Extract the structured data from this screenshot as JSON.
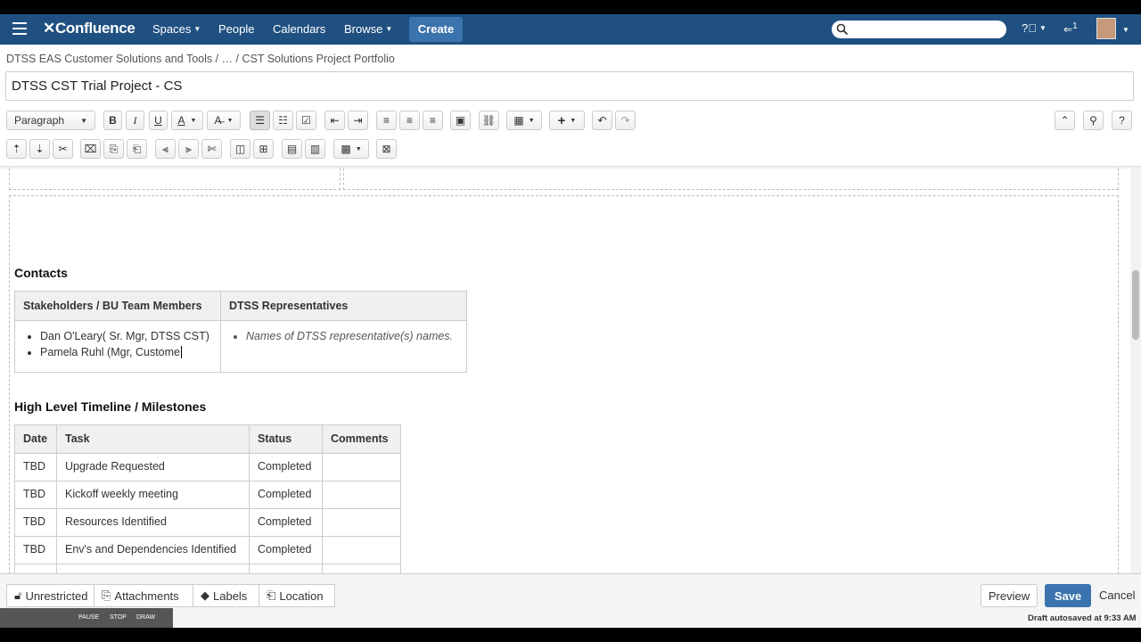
{
  "nav": {
    "logo": "Confluence",
    "items": [
      "Spaces",
      "People",
      "Calendars",
      "Browse"
    ],
    "create": "Create",
    "notif_count": "1"
  },
  "breadcrumb": "DTSS EAS Customer Solutions and Tools / … / CST Solutions Project Portfolio",
  "page_title": "DTSS CST Trial Project - CS",
  "toolbar": {
    "paragraph": "Paragraph",
    "bold": "B",
    "italic": "I",
    "underline": "U",
    "color": "A"
  },
  "contacts": {
    "heading": "Contacts",
    "col1": "Stakeholders / BU Team Members",
    "col2": "DTSS Representatives",
    "stakeholders": [
      "Dan O'Leary( Sr. Mgr, DTSS CST)",
      "Pamela Ruhl (Mgr, Custome"
    ],
    "reps": [
      "Names of DTSS representative(s) names."
    ]
  },
  "milestones": {
    "heading": "High Level Timeline / Milestones",
    "columns": [
      "Date",
      "Task",
      "Status",
      "Comments"
    ],
    "rows": [
      [
        "TBD",
        "Upgrade Requested",
        "Completed",
        ""
      ],
      [
        "TBD",
        "Kickoff weekly meeting",
        "Completed",
        ""
      ],
      [
        "TBD",
        "Resources Identified",
        "Completed",
        ""
      ],
      [
        "TBD",
        "Env's and Dependencies Identified",
        "Completed",
        ""
      ]
    ]
  },
  "footer": {
    "restrictions": "Unrestricted",
    "attachments": "Attachments",
    "labels": "Labels",
    "location": "Location",
    "preview": "Preview",
    "save": "Save",
    "cancel": "Cancel",
    "autosave": "Draft autosaved at 9:33 AM",
    "recorder": [
      "PAUSE",
      "STOP",
      "DRAW"
    ]
  }
}
